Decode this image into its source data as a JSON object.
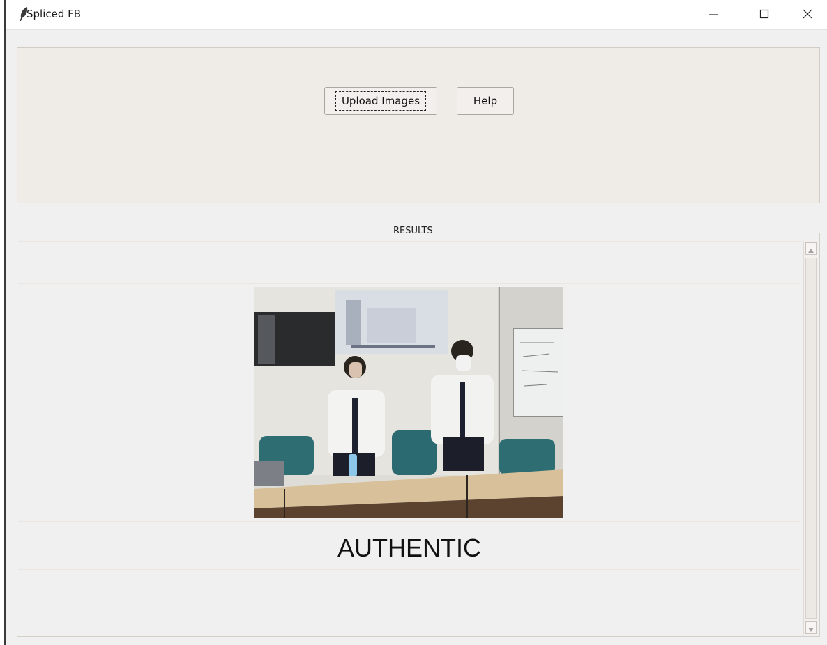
{
  "window": {
    "title": "Spliced FB",
    "icon": "feather-icon",
    "controls": [
      "minimize-icon",
      "maximize-icon",
      "close-icon"
    ]
  },
  "toolbar": {
    "upload_label": "Upload Images",
    "help_label": "Help"
  },
  "results": {
    "label": "RESULTS",
    "verdict": "AUTHENTIC",
    "image_content": "photo of two people standing in a meeting room"
  }
}
